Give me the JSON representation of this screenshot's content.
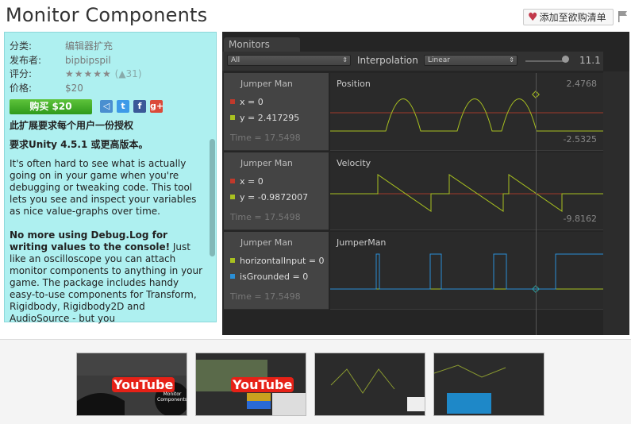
{
  "header": {
    "title": "Monitor Components",
    "wishlist_label": "添加至欲购清单"
  },
  "sidebar": {
    "category_label": "分类:",
    "category_value": "编辑器扩充",
    "publisher_label": "发布者:",
    "publisher_value": "bipbipspil",
    "rating_label": "评分:",
    "rating_stars": "★★★★★",
    "rating_count": "31",
    "price_label": "价格:",
    "price_value": "$20",
    "buy_label": "购买 $20",
    "license_note": "此扩展要求每个用户一份授权",
    "version_note": "要求Unity 4.5.1 或更高版本。",
    "desc_p1": "It's often hard to see what is actually going on in your game when you're debugging or tweaking code. This tool lets you see and inspect your variables as nice value-graphs over time.",
    "desc_p2_bold": "No more using Debug.Log for writing values to the console!",
    "desc_p2": " Just like an oscilloscope you can attach monitor components to anything in your game. The package includes handy easy-to-use components for Transform, Rigidbody, Rigidbody2D and AudioSource - but you"
  },
  "video": {
    "tab": "Monitors",
    "filter": "All",
    "interpolation_label": "Interpolation",
    "interpolation_value": "Linear",
    "zoom": "11.1",
    "rows": [
      {
        "object": "Jumper Man",
        "vars": [
          {
            "text": "x = 0",
            "color": "#c0392b"
          },
          {
            "text": "y = 2.417295",
            "color": "#a8c020"
          }
        ],
        "time": "Time = 17.5498",
        "graph": "Position",
        "max": "2.4768",
        "min": "-2.5325"
      },
      {
        "object": "Jumper Man",
        "vars": [
          {
            "text": "x = 0",
            "color": "#c0392b"
          },
          {
            "text": "y = -0.9872007",
            "color": "#a8c020"
          }
        ],
        "time": "Time = 17.5498",
        "graph": "Velocity",
        "max": "",
        "min": "-9.8162"
      },
      {
        "object": "Jumper Man",
        "vars": [
          {
            "text": "horizontalInput = 0",
            "color": "#a8c020"
          },
          {
            "text": "isGrounded = 0",
            "color": "#2a8fd6"
          }
        ],
        "time": "Time = 17.5498",
        "graph": "JumperMan",
        "max": "",
        "min": ""
      }
    ]
  },
  "thumbs": {
    "yt1": "YouTube",
    "yt2": "YouTube",
    "t1_caption": "Monitor Components"
  }
}
